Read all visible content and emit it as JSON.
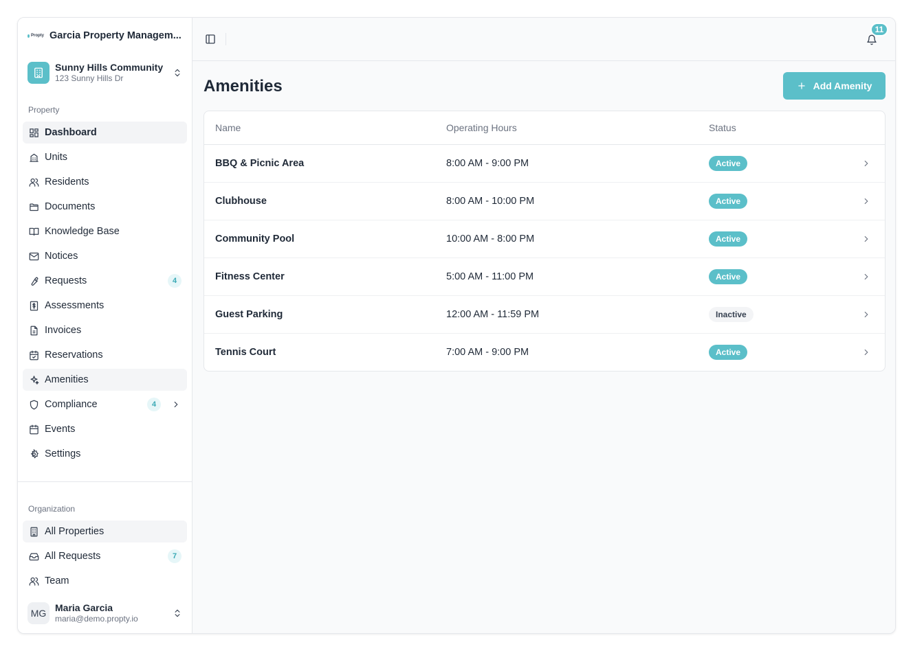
{
  "brand": {
    "logo_text": "Propty",
    "name": "Garcia Property Managem..."
  },
  "property": {
    "name": "Sunny Hills Community",
    "address": "123 Sunny Hills Dr"
  },
  "sidebar": {
    "property_section_label": "Property",
    "property_items": [
      {
        "label": "Dashboard",
        "icon": "dashboard-icon"
      },
      {
        "label": "Units",
        "icon": "building-icon"
      },
      {
        "label": "Residents",
        "icon": "users-icon"
      },
      {
        "label": "Documents",
        "icon": "folder-icon"
      },
      {
        "label": "Knowledge Base",
        "icon": "book-icon"
      },
      {
        "label": "Notices",
        "icon": "mail-icon"
      },
      {
        "label": "Requests",
        "icon": "wrench-icon",
        "badge": "4"
      },
      {
        "label": "Assessments",
        "icon": "dollar-icon"
      },
      {
        "label": "Invoices",
        "icon": "file-icon"
      },
      {
        "label": "Reservations",
        "icon": "calendar-check-icon"
      },
      {
        "label": "Amenities",
        "icon": "sparkles-icon"
      },
      {
        "label": "Compliance",
        "icon": "shield-icon",
        "badge": "4"
      },
      {
        "label": "Events",
        "icon": "calendar-icon"
      },
      {
        "label": "Settings",
        "icon": "gear-icon"
      }
    ],
    "organization_section_label": "Organization",
    "organization_items": [
      {
        "label": "All Properties",
        "icon": "office-building-icon"
      },
      {
        "label": "All Requests",
        "icon": "inbox-icon",
        "badge": "7"
      },
      {
        "label": "Team",
        "icon": "team-icon"
      }
    ]
  },
  "user": {
    "initials": "MG",
    "name": "Maria Garcia",
    "email": "maria@demo.propty.io"
  },
  "topbar": {
    "notification_count": "11"
  },
  "page": {
    "title": "Amenities",
    "add_button_label": "Add Amenity"
  },
  "table": {
    "columns": [
      "Name",
      "Operating Hours",
      "Status"
    ],
    "rows": [
      {
        "name": "BBQ & Picnic Area",
        "hours": "8:00 AM - 9:00 PM",
        "status": "Active"
      },
      {
        "name": "Clubhouse",
        "hours": "8:00 AM - 10:00 PM",
        "status": "Active"
      },
      {
        "name": "Community Pool",
        "hours": "10:00 AM - 8:00 PM",
        "status": "Active"
      },
      {
        "name": "Fitness Center",
        "hours": "5:00 AM - 11:00 PM",
        "status": "Active"
      },
      {
        "name": "Guest Parking",
        "hours": "12:00 AM - 11:59 PM",
        "status": "Inactive"
      },
      {
        "name": "Tennis Court",
        "hours": "7:00 AM - 9:00 PM",
        "status": "Active"
      }
    ]
  },
  "colors": {
    "accent": "#5bbfc9",
    "badge_soft_bg": "#e6f6f8",
    "inactive_bg": "#f3f4f6"
  }
}
